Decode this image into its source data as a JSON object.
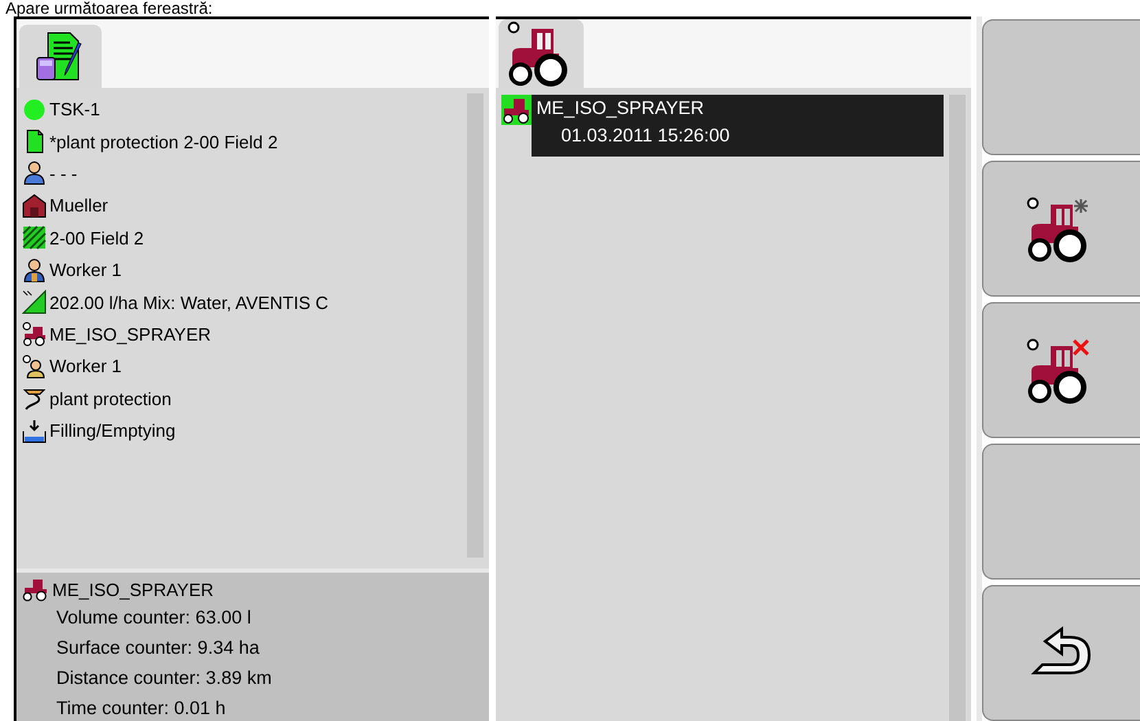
{
  "caption": "Apare următoarea fereastră:",
  "task_list": [
    {
      "kind": "status",
      "label": "TSK-1"
    },
    {
      "kind": "document",
      "label": "*plant protection 2-00 Field 2"
    },
    {
      "kind": "customer",
      "label": "- - -"
    },
    {
      "kind": "farm",
      "label": "Mueller"
    },
    {
      "kind": "field",
      "label": "2-00 Field 2"
    },
    {
      "kind": "worker",
      "label": "Worker 1"
    },
    {
      "kind": "product",
      "label": "202.00 l/ha Mix: Water, AVENTIS C"
    },
    {
      "kind": "machine",
      "label": "ME_ISO_SPRAYER"
    },
    {
      "kind": "operator",
      "label": "Worker 1"
    },
    {
      "kind": "operation",
      "label": "plant protection"
    },
    {
      "kind": "filling",
      "label": "Filling/Emptying"
    }
  ],
  "counters": {
    "machine": "ME_ISO_SPRAYER",
    "lines": [
      "Volume counter: 63.00 l",
      "Surface counter: 9.34 ha",
      "Distance counter: 3.89 km",
      "Time counter: 0.01 h"
    ]
  },
  "machines": [
    {
      "name": "ME_ISO_SPRAYER",
      "timestamp": "01.03.2011  15:26:00",
      "selected": true
    }
  ],
  "softkeys": [
    {
      "kind": "blank"
    },
    {
      "kind": "add-machine"
    },
    {
      "kind": "remove-machine"
    },
    {
      "kind": "blank"
    },
    {
      "kind": "back"
    }
  ]
}
